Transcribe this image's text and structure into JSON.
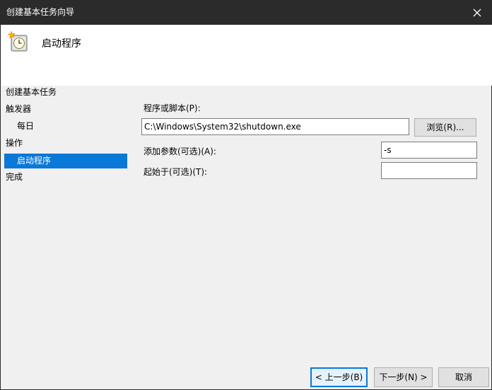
{
  "window": {
    "title": "创建基本任务向导"
  },
  "header": {
    "title": "启动程序"
  },
  "nav": {
    "items": [
      {
        "label": "创建基本任务"
      },
      {
        "label": "触发器"
      },
      {
        "label": "每日"
      },
      {
        "label": "操作"
      },
      {
        "label": "启动程序"
      },
      {
        "label": "完成"
      }
    ]
  },
  "form": {
    "program_label": "程序或脚本(P):",
    "program_value": "C:\\Windows\\System32\\shutdown.exe",
    "browse_label": "浏览(R)...",
    "args_label": "添加参数(可选)(A):",
    "args_value": "-s",
    "startin_label": "起始于(可选)(T):",
    "startin_value": ""
  },
  "footer": {
    "back_label": "< 上一步(B)",
    "next_label": "下一步(N) >",
    "cancel_label": "取消"
  },
  "colors": {
    "accent": "#0a78d7",
    "titlebar": "#2b2b2b",
    "panel": "#f0f0f0"
  }
}
